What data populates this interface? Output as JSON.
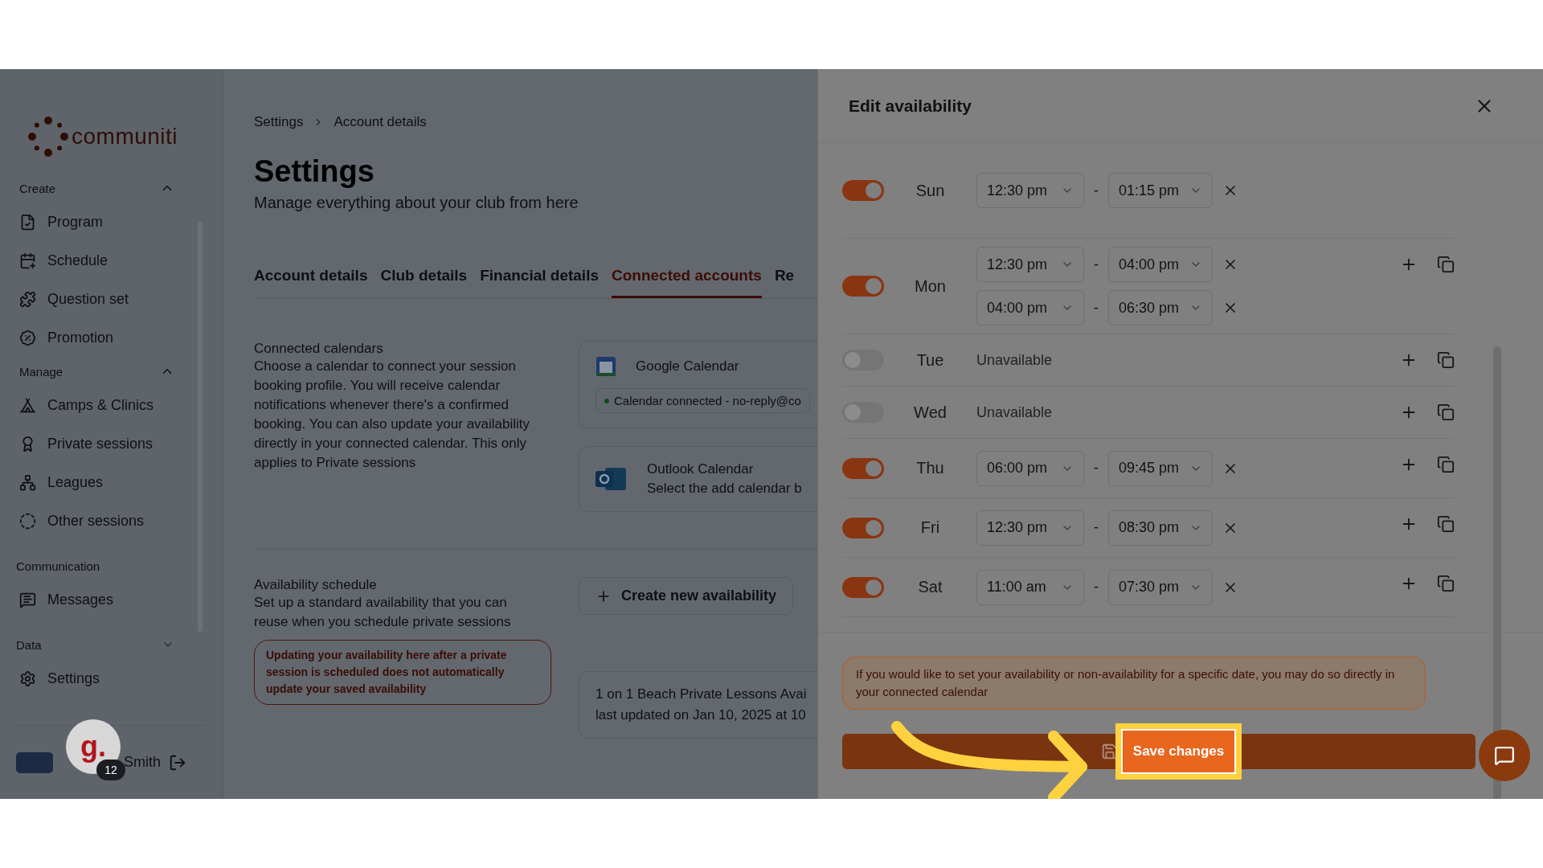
{
  "logo": "communiti",
  "sidebar": {
    "sections": [
      {
        "title": "Create",
        "expanded": true,
        "items": [
          "Program",
          "Schedule",
          "Question set",
          "Promotion"
        ]
      },
      {
        "title": "Manage",
        "expanded": true,
        "items": [
          "Camps & Clinics",
          "Private sessions",
          "Leagues",
          "Other sessions"
        ]
      },
      {
        "title": "Communication",
        "items": [
          "Messages"
        ]
      },
      {
        "title": "Data",
        "expanded": false,
        "items": [
          "Settings"
        ]
      }
    ]
  },
  "user": {
    "name": "Smith",
    "avatar_letter": "g.",
    "badge": "12"
  },
  "breadcrumb": [
    "Settings",
    "Account details"
  ],
  "page": {
    "title": "Settings",
    "subtitle": "Manage everything about your club from here"
  },
  "tabs": [
    {
      "label": "Account details",
      "selected": false
    },
    {
      "label": "Club details",
      "selected": false
    },
    {
      "label": "Financial details",
      "selected": false
    },
    {
      "label": "Connected accounts",
      "selected": true
    },
    {
      "label": "Re",
      "selected": false
    }
  ],
  "connected_calendars": {
    "title": "Connected calendars",
    "description": "Choose a calendar to connect your session booking profile. You will receive calendar notifications whenever there's a confirmed booking. You can also update your availability directly in your connected calendar. This only applies to Private sessions",
    "cards": [
      {
        "kind": "google",
        "name": "Google Calendar",
        "status": "Calendar connected - no-reply@co"
      },
      {
        "kind": "outlook",
        "name": "Outlook Calendar",
        "status": "Select the add calendar b"
      }
    ]
  },
  "availability_schedule": {
    "title": "Availability schedule",
    "description": "Set up a standard availability that you can reuse when you schedule private sessions",
    "warning": "Updating your availability here after a private session is scheduled does not automatically update your saved availability",
    "create_button": "Create new availability",
    "schedule": {
      "title": "1 on 1 Beach Private Lessons Avai",
      "updated": "last updated on Jan 10, 2025 at 10"
    }
  },
  "modal": {
    "title": "Edit availability",
    "days": [
      {
        "day": "Sun",
        "on": true,
        "actions": false,
        "slots": [
          {
            "start": "12:30 pm",
            "end": "01:15 pm"
          }
        ]
      },
      {
        "day": "Mon",
        "on": true,
        "actions": true,
        "slots": [
          {
            "start": "12:30 pm",
            "end": "04:00 pm"
          },
          {
            "start": "04:00 pm",
            "end": "06:30 pm"
          }
        ]
      },
      {
        "day": "Tue",
        "on": false,
        "actions": true,
        "status": "Unavailable"
      },
      {
        "day": "Wed",
        "on": false,
        "actions": true,
        "status": "Unavailable"
      },
      {
        "day": "Thu",
        "on": true,
        "actions": true,
        "slots": [
          {
            "start": "06:00 pm",
            "end": "09:45 pm"
          }
        ]
      },
      {
        "day": "Fri",
        "on": true,
        "actions": true,
        "slots": [
          {
            "start": "12:30 pm",
            "end": "08:30 pm"
          }
        ]
      },
      {
        "day": "Sat",
        "on": true,
        "actions": true,
        "slots": [
          {
            "start": "11:00 am",
            "end": "07:30 pm"
          }
        ]
      }
    ],
    "separator": "-",
    "notice": "If you would like to set your availability or non-availability for a specific date, you may do so directly in your connected calendar",
    "save_button": "Save changes"
  }
}
